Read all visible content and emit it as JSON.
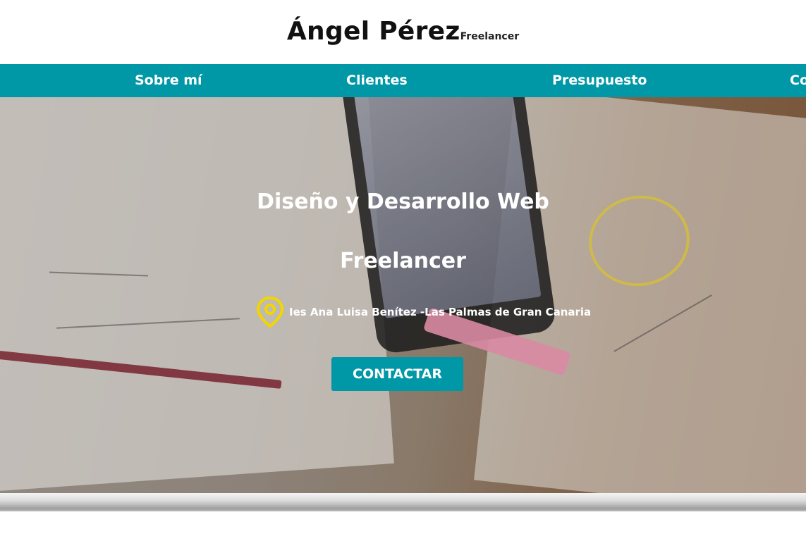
{
  "brand": {
    "name": "Ángel Pérez",
    "tagline": "Freelancer"
  },
  "nav": {
    "items": [
      {
        "label": "Sobre mí"
      },
      {
        "label": "Clientes"
      },
      {
        "label": "Presupuesto"
      },
      {
        "label": "Co"
      }
    ]
  },
  "hero": {
    "title": "Diseño y Desarrollo Web",
    "subtitle": "Freelancer",
    "location": "Ies Ana Luisa Benítez -Las Palmas de Gran Canaria",
    "location_icon": "map-pin-icon",
    "cta_label": "CONTACTAR"
  },
  "colors": {
    "accent": "#0097a7",
    "pin": "#f2d600"
  }
}
